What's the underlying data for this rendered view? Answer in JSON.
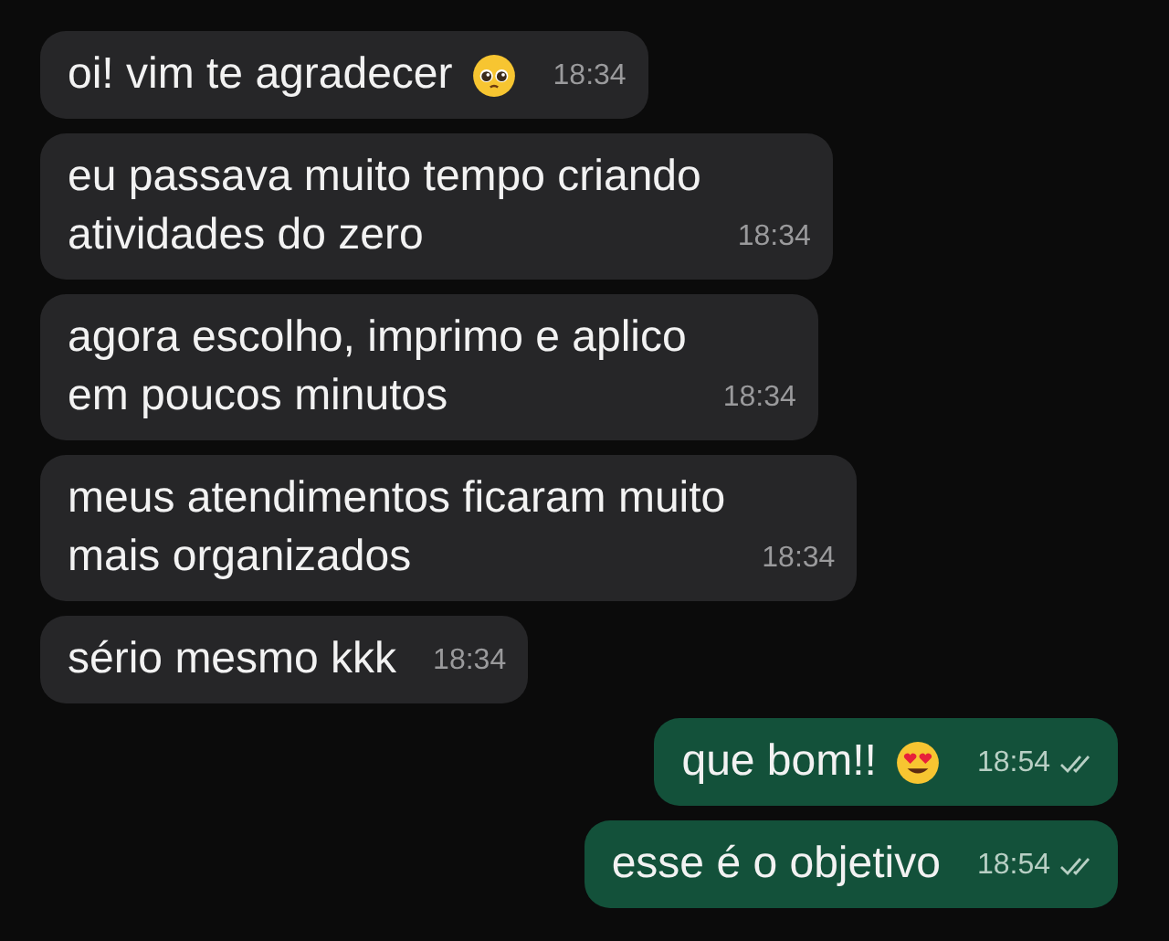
{
  "messages": [
    {
      "kind": "received",
      "lines": [
        "oi! vim te agradecer"
      ],
      "emoji": {
        "kind": "pleading"
      },
      "time": "18:34"
    },
    {
      "kind": "received",
      "lines": [
        "eu passava muito tempo criando",
        "atividades do zero"
      ],
      "time": "18:34"
    },
    {
      "kind": "received",
      "lines": [
        "agora escolho, imprimo e aplico",
        "em poucos minutos"
      ],
      "time": "18:34"
    },
    {
      "kind": "received",
      "lines": [
        "meus atendimentos ficaram muito",
        "mais organizados"
      ],
      "time": "18:34"
    },
    {
      "kind": "received",
      "lines": [
        "sério mesmo kkk"
      ],
      "time": "18:34"
    },
    {
      "kind": "sent",
      "lines": [
        "que bom!!"
      ],
      "emoji": {
        "kind": "heart_eyes"
      },
      "time": "18:54",
      "read": true
    },
    {
      "kind": "sent",
      "lines": [
        "esse é o objetivo"
      ],
      "time": "18:54",
      "read": true
    }
  ]
}
